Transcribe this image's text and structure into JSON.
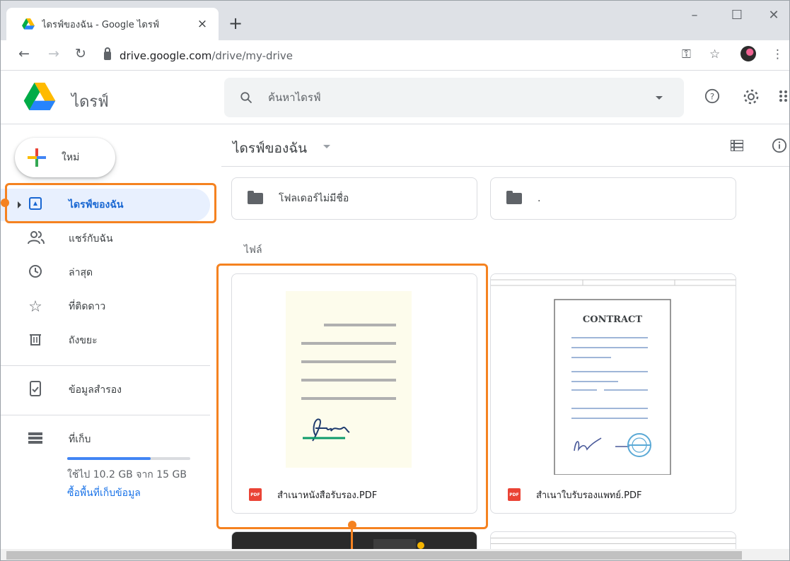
{
  "browser": {
    "tab_title": "ไดรฟ์ของฉัน - Google ไดรฟ์",
    "url_host": "drive.google.com",
    "url_path": "/drive/my-drive",
    "new_tab_symbol": "+",
    "close_symbol": "×",
    "icons": {
      "back": "arrow-left-icon",
      "forward": "arrow-right-icon",
      "reload": "reload-icon",
      "key": "key-icon",
      "bookmark": "star-icon",
      "menu": "kebab-menu-icon"
    }
  },
  "drive": {
    "app_name": "ไดรฟ์",
    "search_placeholder": "ค้นหาไดรฟ์",
    "header_icons": [
      "help-icon",
      "settings-icon",
      "apps-grid-icon"
    ]
  },
  "sidebar": {
    "new_label": "ใหม่",
    "items": [
      {
        "label": "ไดรฟ์ของฉัน",
        "icon": "my-drive-icon",
        "active": true
      },
      {
        "label": "แชร์กับฉัน",
        "icon": "shared-icon"
      },
      {
        "label": "ล่าสุด",
        "icon": "clock-icon"
      },
      {
        "label": "ที่ติดดาว",
        "icon": "star-icon"
      },
      {
        "label": "ถังขยะ",
        "icon": "trash-icon"
      },
      {
        "label": "ข้อมูลสำรอง",
        "icon": "backup-icon"
      },
      {
        "label": "ที่เก็บ",
        "icon": "storage-icon"
      }
    ],
    "storage_used_text": "ใช้ไป 10.2 GB จาก 15 GB",
    "storage_fraction": 0.68,
    "storage_link": "ซื้อพื้นที่เก็บข้อมูล"
  },
  "main": {
    "title": "ไดรฟ์ของฉัน",
    "folders": [
      {
        "name": "โฟลเดอร์ไม่มีชื่อ"
      },
      {
        "name": "."
      }
    ],
    "files_section_label": "ไฟล์",
    "files": [
      {
        "name": "สำเนาหนังสือรับรอง.PDF",
        "type_badge": "PDF"
      },
      {
        "name": "สำเนาใบรับรองแพทย์.PDF",
        "type_badge": "PDF",
        "thumb_heading": "CONTRACT"
      }
    ]
  },
  "colors": {
    "annotation": "#f58220",
    "accent_blue": "#1a73e8",
    "active_bg": "#e8f0fe",
    "pdf_red": "#ea4335"
  }
}
